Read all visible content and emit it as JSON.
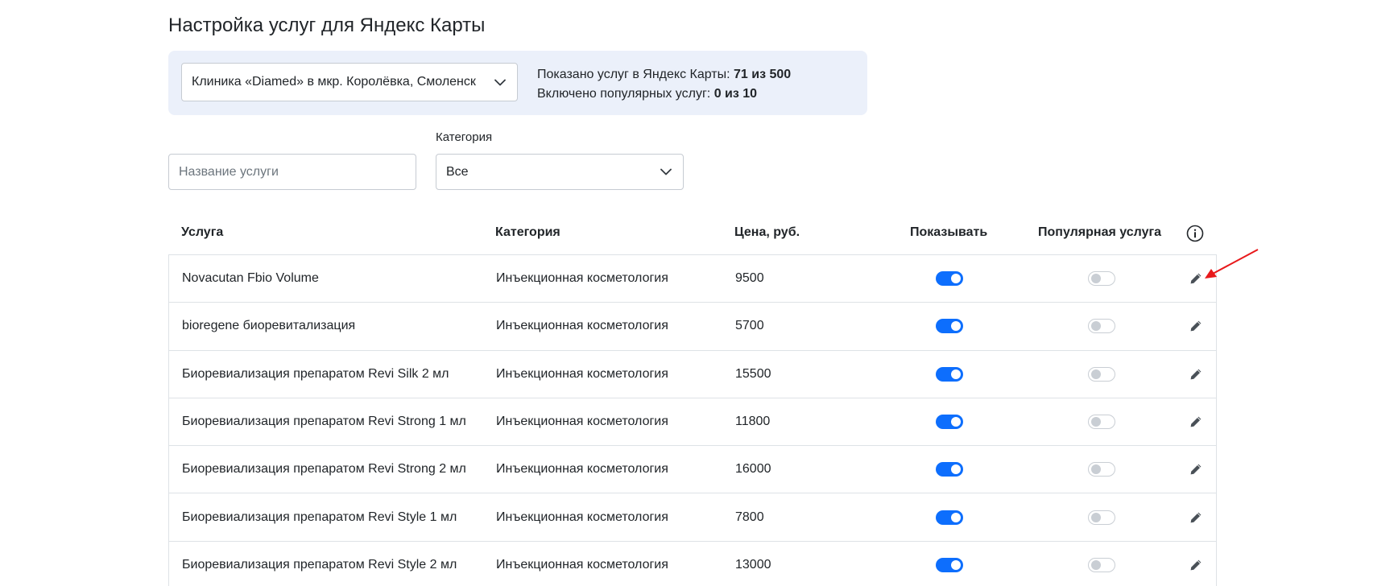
{
  "page": {
    "title": "Настройка услуг для Яндекс Карты"
  },
  "info_panel": {
    "clinic_select_value": "Клиника «Diamed» в мкр. Королёвка, Смоленск",
    "shown_label": "Показано услуг в Яндекс Карты: ",
    "shown_value": "71 из 500",
    "popular_label": "Включено популярных услуг: ",
    "popular_value": "0 из 10"
  },
  "filters": {
    "search_placeholder": "Название услуги",
    "category_label": "Категория",
    "category_value": "Все"
  },
  "table": {
    "headers": {
      "service": "Услуга",
      "category": "Категория",
      "price": "Цена, руб.",
      "show": "Показывать",
      "popular": "Популярная услуга"
    },
    "rows": [
      {
        "name": "Novacutan Fbio Volume",
        "category": "Инъекционная косметология",
        "price": "9500",
        "show": true,
        "popular": false
      },
      {
        "name": "bioregene биоревитализация",
        "category": "Инъекционная косметология",
        "price": "5700",
        "show": true,
        "popular": false
      },
      {
        "name": "Биоревиализация препаратом Revi Silk 2 мл",
        "category": "Инъекционная косметология",
        "price": "15500",
        "show": true,
        "popular": false
      },
      {
        "name": "Биоревиализация препаратом Revi Strong 1 мл",
        "category": "Инъекционная косметология",
        "price": "11800",
        "show": true,
        "popular": false
      },
      {
        "name": "Биоревиализация препаратом Revi Strong 2 мл",
        "category": "Инъекционная косметология",
        "price": "16000",
        "show": true,
        "popular": false
      },
      {
        "name": "Биоревиализация препаратом Revi Style 1 мл",
        "category": "Инъекционная косметология",
        "price": "7800",
        "show": true,
        "popular": false
      },
      {
        "name": "Биоревиализация препаратом Revi Style 2 мл",
        "category": "Инъекционная косметология",
        "price": "13000",
        "show": true,
        "popular": false
      }
    ]
  },
  "icons": {
    "chevron": "chevron-down-icon",
    "info": "info-circle-icon",
    "edit": "pencil-icon",
    "annotation": "red-arrow"
  },
  "colors": {
    "accent": "#0d6efd",
    "panel_bg": "#ebf0fa",
    "annotation": "#e8191b"
  }
}
